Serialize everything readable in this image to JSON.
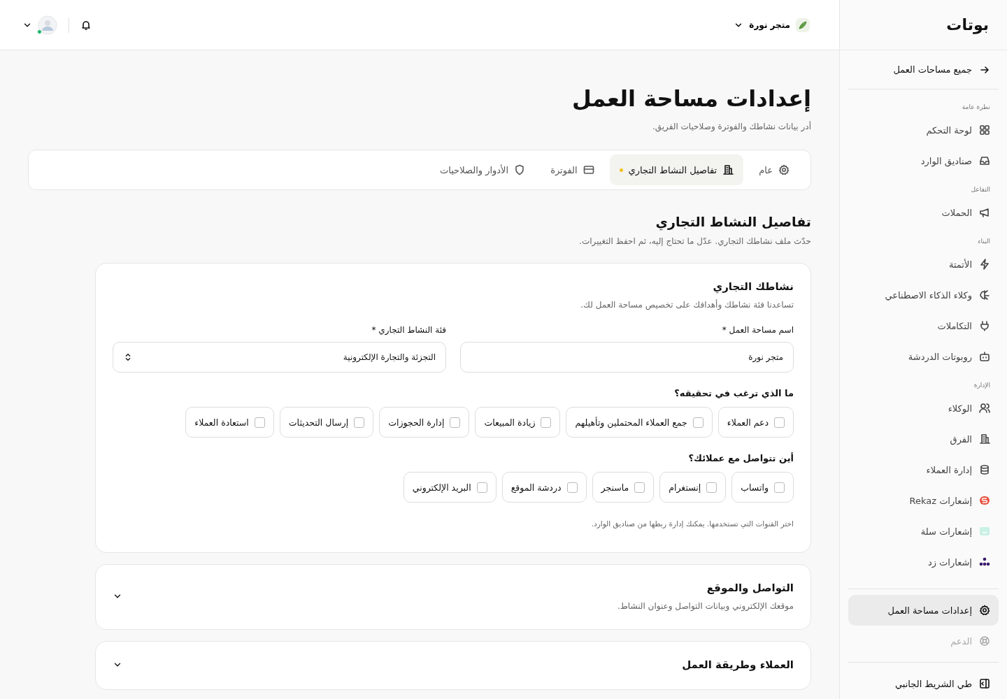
{
  "sidebar": {
    "logo": "بوتات",
    "back_link": {
      "label": "جميع مساحات العمل"
    },
    "groups": [
      {
        "heading": "نظرة عامة",
        "items": [
          {
            "label": "لوحة التحكم",
            "selected": false,
            "disabled": false
          },
          {
            "label": "صناديق الوارد",
            "selected": false,
            "disabled": false
          }
        ]
      },
      {
        "heading": "التفاعل",
        "items": [
          {
            "label": "الحملات",
            "selected": false,
            "disabled": false
          }
        ]
      },
      {
        "heading": "البناء",
        "items": [
          {
            "label": "الأتمتة",
            "selected": false,
            "disabled": false
          },
          {
            "label": "وكلاء الذكاء الاصطناعي",
            "selected": false,
            "disabled": false
          },
          {
            "label": "التكاملات",
            "selected": false,
            "disabled": false
          },
          {
            "label": "روبوتات الدردشة",
            "selected": false,
            "disabled": false
          }
        ]
      },
      {
        "heading": "الإدارة",
        "items": [
          {
            "label": "الوكلاء",
            "selected": false,
            "disabled": false
          },
          {
            "label": "الفرق",
            "selected": false,
            "disabled": false
          },
          {
            "label": "إدارة العملاء",
            "selected": false,
            "disabled": false
          },
          {
            "label": "إشعارات Rekaz",
            "selected": false,
            "disabled": false
          },
          {
            "label": "إشعارات سلة",
            "selected": false,
            "disabled": false
          },
          {
            "label": "إشعارات زد",
            "selected": false,
            "disabled": false
          }
        ]
      }
    ],
    "footer_items": [
      {
        "label": "إعدادات مساحة العمل",
        "selected": true,
        "disabled": false
      },
      {
        "label": "الدعم",
        "selected": false,
        "disabled": true
      }
    ],
    "collapse": {
      "label": "طي الشريط الجانبي"
    }
  },
  "topbar": {
    "store": {
      "name": "متجر نورة"
    },
    "user": {
      "online": true
    }
  },
  "page": {
    "title": "إعدادات مساحة العمل",
    "subtitle": "أدر بيانات نشاطك والفوترة وصلاحيات الفريق."
  },
  "tabs": [
    {
      "label": "عام",
      "selected": false,
      "unsaved": false
    },
    {
      "label": "تفاصيل النشاط التجاري",
      "selected": true,
      "unsaved": true
    },
    {
      "label": "الفوترة",
      "selected": false,
      "unsaved": false
    },
    {
      "label": "الأدوار والصلاحيات",
      "selected": false,
      "unsaved": false
    }
  ],
  "section": {
    "title": "تفاصيل النشاط التجاري",
    "subtitle": "حدّث ملف نشاطك التجاري. عدّل ما تحتاج إليه، ثم احفظ التغييرات."
  },
  "business_card": {
    "title": "نشاطك التجاري",
    "subtitle": "تساعدنا فئة نشاطك وأهدافك على تخصيص مساحة العمل لك.",
    "fields": [
      {
        "kind": "text",
        "label": "اسم مساحة العمل *",
        "value": "متجر نورة"
      },
      {
        "kind": "select",
        "label": "فئة النشاط التجاري *",
        "value": "التجزئة والتجارة الإلكترونية"
      }
    ],
    "goals": {
      "question": "ما الذي ترغب في تحقيقه؟",
      "options": [
        {
          "label": "دعم العملاء",
          "checked": false
        },
        {
          "label": "جمع العملاء المحتملين وتأهيلهم",
          "checked": false
        },
        {
          "label": "زيادة المبيعات",
          "checked": false
        },
        {
          "label": "إدارة الحجوزات",
          "checked": false
        },
        {
          "label": "إرسال التحديثات",
          "checked": false
        },
        {
          "label": "استعادة العملاء",
          "checked": false
        }
      ]
    },
    "channels": {
      "question": "أين تتواصل مع عملائك؟",
      "options": [
        {
          "label": "واتساب",
          "checked": false
        },
        {
          "label": "إنستغرام",
          "checked": false
        },
        {
          "label": "ماسنجر",
          "checked": false
        },
        {
          "label": "دردشة الموقع",
          "checked": false
        },
        {
          "label": "البريد الإلكتروني",
          "checked": false
        }
      ],
      "hint": "اختر القنوات التي تستخدمها. يمكنك إدارة ربطها من صناديق الوارد."
    }
  },
  "collapsed_sections": [
    {
      "title": "التواصل والموقع",
      "subtitle": "موقعك الإلكتروني وبيانات التواصل وعنوان النشاط.",
      "expanded": false
    },
    {
      "title": "العملاء وطريقة العمل",
      "expanded": false
    }
  ]
}
